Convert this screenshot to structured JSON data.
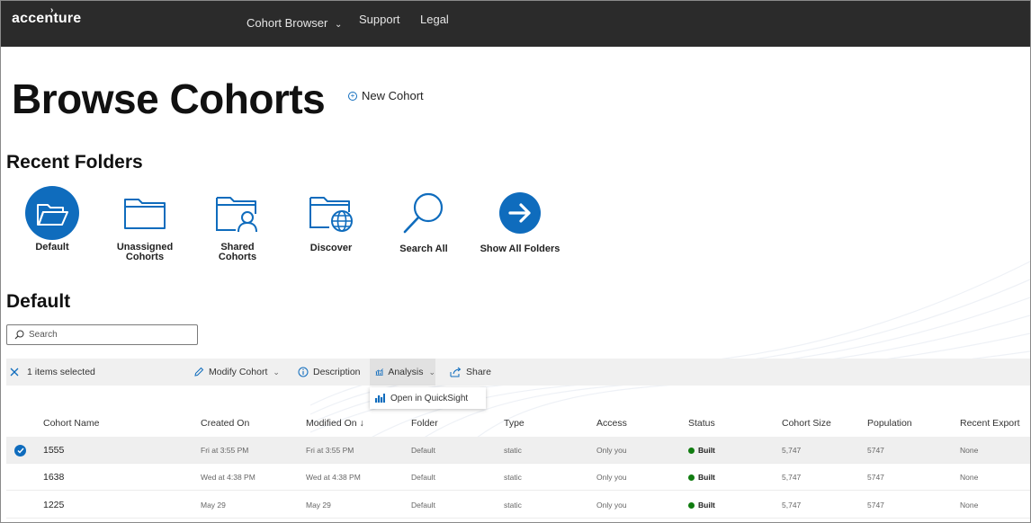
{
  "nav": {
    "brand": "accenture",
    "items": [
      {
        "label": "Cohort Browser"
      },
      {
        "label": "Support"
      },
      {
        "label": "Legal"
      }
    ]
  },
  "page": {
    "title": "Browse Cohorts",
    "new_cohort_label": "New Cohort"
  },
  "recent_folders": {
    "title": "Recent Folders",
    "folders": [
      {
        "label": "Default",
        "icon": "folder-open-icon"
      },
      {
        "label": "Unassigned Cohorts",
        "icon": "folder-icon"
      },
      {
        "label": "Shared Cohorts",
        "icon": "folder-person-icon"
      },
      {
        "label": "Discover",
        "icon": "folder-globe-icon"
      },
      {
        "label": "Search All",
        "icon": "search-icon"
      },
      {
        "label": "Show All Folders",
        "icon": "arrow-right-icon"
      }
    ]
  },
  "default_section": {
    "title": "Default",
    "search_placeholder": "Search"
  },
  "command_bar": {
    "selection_text": "1 items selected",
    "modify_label": "Modify Cohort",
    "description_label": "Description",
    "analysis_label": "Analysis",
    "share_label": "Share",
    "analysis_menu": [
      "Open in QuickSight"
    ]
  },
  "table": {
    "columns": [
      "Cohort Name",
      "Created On",
      "Modified On ↓",
      "Folder",
      "Type",
      "Access",
      "Status",
      "Cohort Size",
      "Population",
      "Recent Export"
    ],
    "rows": [
      {
        "name": "1555",
        "created": "Fri at 3:55 PM",
        "modified": "Fri at 3:55 PM",
        "folder": "Default",
        "type": "static",
        "access": "Only you",
        "status": "Built",
        "size": "5,747",
        "population": "5747",
        "export": "None",
        "selected": true
      },
      {
        "name": "1638",
        "created": "Wed at 4:38 PM",
        "modified": "Wed at 4:38 PM",
        "folder": "Default",
        "type": "static",
        "access": "Only you",
        "status": "Built",
        "size": "5,747",
        "population": "5747",
        "export": "None",
        "selected": false
      },
      {
        "name": "1225",
        "created": "May 29",
        "modified": "May 29",
        "folder": "Default",
        "type": "static",
        "access": "Only you",
        "status": "Built",
        "size": "5,747",
        "population": "5747",
        "export": "None",
        "selected": false
      }
    ]
  },
  "colors": {
    "nav_bg": "#2b2b2b",
    "accent": "#0f6cbd",
    "status_built": "#107c10"
  }
}
